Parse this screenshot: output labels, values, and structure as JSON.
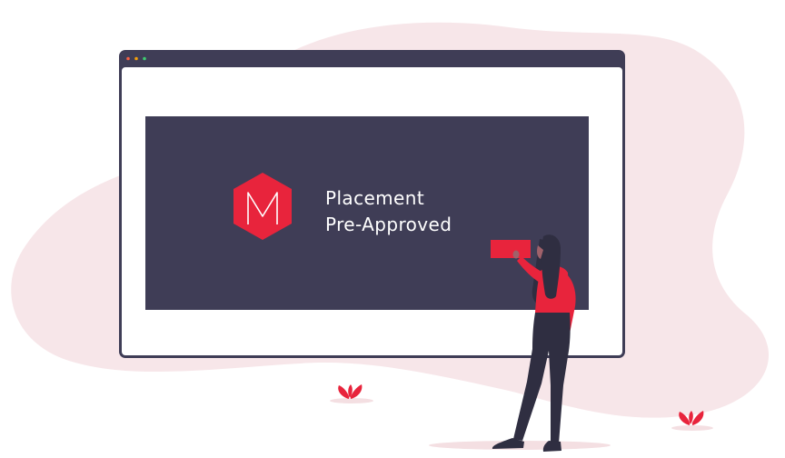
{
  "banner": {
    "logo_letter": "M",
    "line1": "Placement",
    "line2": "Pre-Approved"
  },
  "colors": {
    "background": "#ffffff",
    "blob": "#f7e6e9",
    "window_frame": "#3f3d56",
    "window_body": "#ffffff",
    "banner_panel": "#3f3d56",
    "brand_red": "#e8243c",
    "dot_red": "#f55f44",
    "dot_yellow": "#f49f0a",
    "dot_green": "#3ecc71",
    "skin": "#a0616a",
    "hair": "#2f2e41"
  },
  "icons": {
    "logo": "hexagon-m-logo-icon",
    "plants": "flower-plant-icon"
  }
}
